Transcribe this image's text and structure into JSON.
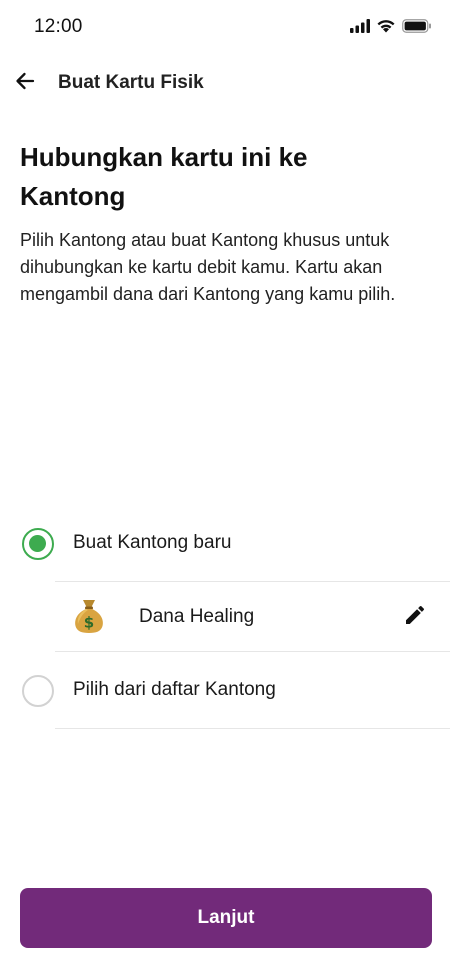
{
  "status_bar": {
    "time": "12:00",
    "icons": [
      "signal-icon",
      "wifi-icon",
      "battery-icon"
    ]
  },
  "nav": {
    "back_icon": "arrow-left-icon",
    "title": "Buat Kartu Fisik"
  },
  "heading": "Hubungkan kartu ini ke Kantong",
  "description": "Pilih Kantong atau buat Kantong khusus untuk dihubungkan ke kartu debit kamu. Kartu akan mengambil dana dari Kantong yang kamu pilih.",
  "options": [
    {
      "label": "Buat Kantong baru",
      "selected": true
    },
    {
      "label": "Pilih dari daftar Kantong",
      "selected": false
    }
  ],
  "new_pocket": {
    "emoji_icon": "money-bag-icon",
    "name": "Dana Healing",
    "edit_icon": "pencil-icon"
  },
  "primary_button": {
    "label": "Lanjut"
  },
  "colors": {
    "accent_green": "#3dab4f",
    "button_purple": "#722a7a",
    "divider": "#e6e6e6"
  }
}
